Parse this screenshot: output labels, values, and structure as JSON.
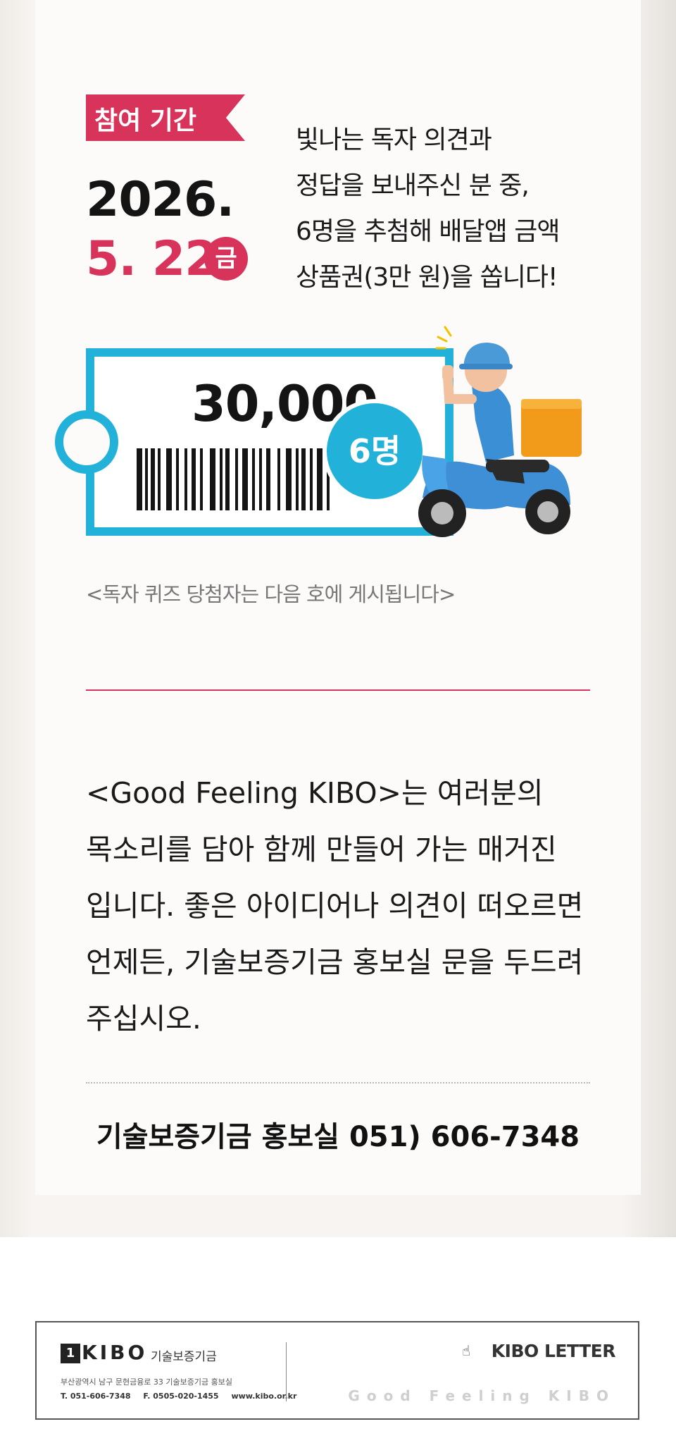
{
  "event": {
    "period_label": "참여 기간",
    "date_year": "2026.",
    "date_month_day": "5. 22.",
    "day_of_week": "금",
    "announcement_lines": [
      "빛나는 독자 의견과",
      "정답을 보내주신 분 중,",
      "6명을 추첨해 배달앱 금액",
      "상품권(3만 원)을 쏩니다!"
    ]
  },
  "voucher": {
    "amount": "30,000",
    "winners": "6명"
  },
  "winners_note": "<독자 퀴즈 당첨자는 다음 호에 게시됩니다>",
  "intro": {
    "lines": [
      "<Good Feeling KIBO>는 여러분의",
      "목소리를 담아 함께 만들어 가는 매거진",
      "입니다. 좋은 아이디어나 의견이 떠오르면",
      "언제든, 기술보증기금 홍보실 문을 두드려",
      "주십시오."
    ]
  },
  "contact": "기술보증기금 홍보실 051) 606-7348",
  "footer": {
    "logo_text": "KIBO",
    "org_name": "기술보증기금",
    "address": "부산광역시 남구 문현금융로 33 기술보증기금 홍보실",
    "tel": "T. 051-606-7348",
    "fax": "F. 0505-020-1455",
    "website": "www.kibo.or.kr",
    "letter_title": "KIBO LETTER",
    "tagline": "Good Feeling KIBO"
  },
  "colors": {
    "accent_red": "#d8335b",
    "accent_blue": "#22b1d8"
  }
}
